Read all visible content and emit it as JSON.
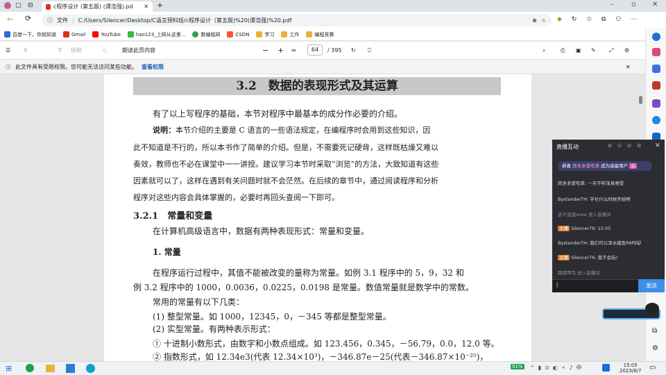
{
  "browser": {
    "tab_title": "c程序设计 (第五版) (谭浩强).pd",
    "url_label": "文件",
    "url": "C:/Users/Silencer/Desktop/C语言预科班/c程序设计（第五版)%20(谭浩强)%20.pdf"
  },
  "bookmarks": [
    {
      "label": "百度一下，你就知道",
      "color": "#2a6ad3"
    },
    {
      "label": "Gmail",
      "color": "#d93025"
    },
    {
      "label": "YouTube",
      "color": "#ff0000"
    },
    {
      "label": "hao123_上网从这里...",
      "color": "#3bb54a"
    },
    {
      "label": "数编程网",
      "color": "#2ea44f"
    },
    {
      "label": "CSDN",
      "color": "#fc5531"
    },
    {
      "label": "学习",
      "color": "#e8b33a"
    },
    {
      "label": "工作",
      "color": "#e8b33a"
    },
    {
      "label": "编程竞赛",
      "color": "#e8b33a"
    }
  ],
  "pdf_toolbar": {
    "draw_label": "绘制",
    "read_aloud": "朗读此页内容",
    "zoom_out": "−",
    "zoom_in": "+",
    "page_current": "64",
    "page_total": "/ 395"
  },
  "infobar": {
    "text": "此文件具有受限权限。您可能无法访问某些功能。",
    "link": "查看权限",
    "close": "✕"
  },
  "document": {
    "section_heading": "3.2　数据的表现形式及其运算",
    "intro": "有了以上写程序的基础，本节对程序中最基本的成分作必要的介绍。",
    "note_label": "说明：",
    "note_lines": [
      "本节介绍的主要是 C 语言的一些语法规定，在编程序时会用到这些知识，因",
      "此不知道是不行的，所以本书作了简单的介绍。但是，不需要死记硬背，这样既枯燥又难以",
      "奏效，教师也不必在课堂中一一讲授。建议学习本节时采取“浏览”的方法，大致知道有这些",
      "因素就可以了，这样在遇到有关问题时就不会茫然。在后续的章节中，通过阅读程序和分析",
      "程序对这些内容会具体掌握的，必要时再回头查阅一下即可。"
    ],
    "subsection": "3.2.1　常量和变量",
    "para1": "在计算机高级语言中，数据有两种表现形式：常量和变量。",
    "heading1": "1. 常量",
    "para2a": "在程序运行过程中，其值不能被改变的量称为常量。如例 3.1 程序中的 5，9，32 和",
    "para2b": "例 3.2 程序中的 1000，0.0036，0.0225，0.0198 是常量。数值常量就是数学中的常数。",
    "para3": "常用的常量有以下几类：",
    "item1": "(1) 整型常量。如 1000，12345，0，－345 等都是整型常量。",
    "item2": "(2) 实型常量。有两种表示形式：",
    "item3": "① 十进制小数形式，由数字和小数点组成。如 123.456，0.345，－56.79，0.0，12.0 等。",
    "item4": "② 指数形式，如 12.34e3(代表 12.34×10³)，－346.87e－25(代表－346.87×10⁻²⁵)，"
  },
  "live": {
    "title": "直播互动",
    "banner_prefix": "恭喜",
    "banner_user": "肉多多爱吃草",
    "banner_suffix": "成为高能用户",
    "messages": [
      {
        "badge": "",
        "text": "肉多多爱吃草: 一天不听浑身难受",
        "color": "#cfd3e8"
      },
      {
        "badge": "",
        "text": "BystanderTH: 学长什么时候开始啊",
        "color": "#cfd3e8"
      },
      {
        "badge": "",
        "text": "这不湿湿www 进入直播间",
        "color": "#8e8f9a"
      },
      {
        "badge": "主播",
        "text": "Silencer76: 15:05",
        "color": "#cfd3e8"
      },
      {
        "badge": "",
        "text": "BystanderTH: 我们可以浑水摸鱼R6吗😺",
        "color": "#cfd3e8"
      },
      {
        "badge": "主播",
        "text": "Silencer76: 我不会玩)",
        "color": "#cfd3e8"
      },
      {
        "badge": "",
        "text": "跳跳甲鸟 进入直播间",
        "color": "#8e8f9a"
      }
    ],
    "send": "发送"
  },
  "taskbar": {
    "battery": "91%",
    "time": "15:05",
    "date": "2023/8/7"
  }
}
